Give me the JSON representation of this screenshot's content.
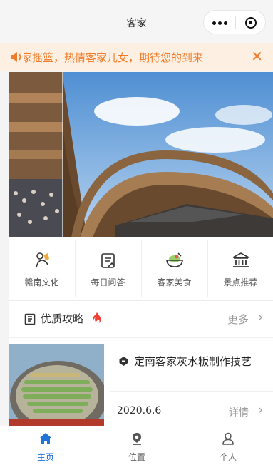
{
  "navbar": {
    "title": "客家",
    "more_icon": "more-dots-icon",
    "close_icon": "target-circle-icon"
  },
  "notice": {
    "icon": "speaker-icon",
    "text": "家摇篮，热情客家儿女，期待您的到来",
    "close_label": "✕",
    "color": "#f07c2a"
  },
  "banner": {
    "icon": "banner-photo"
  },
  "quick_links": [
    {
      "label": "赣南文化",
      "icon": "dancer-icon"
    },
    {
      "label": "每日问答",
      "icon": "notes-icon"
    },
    {
      "label": "客家美食",
      "icon": "food-bowl-icon"
    },
    {
      "label": "景点推荐",
      "icon": "temple-icon"
    }
  ],
  "section": {
    "icon": "book-icon",
    "title": "优质攻略",
    "hot_icon": "fire-icon",
    "more_label": "更多",
    "chevron": "›"
  },
  "article": {
    "icon": "tag-icon",
    "title": "定南客家灰水粄制作技艺",
    "date": "2020.6.6",
    "detail_label": "详情",
    "chevron": "›"
  },
  "tabbar": {
    "active_color": "#1f73d9",
    "tabs": [
      {
        "label": "主页",
        "icon": "home-icon",
        "active": true
      },
      {
        "label": "位置",
        "icon": "location-icon",
        "active": false
      },
      {
        "label": "个人",
        "icon": "person-icon",
        "active": false
      }
    ]
  }
}
